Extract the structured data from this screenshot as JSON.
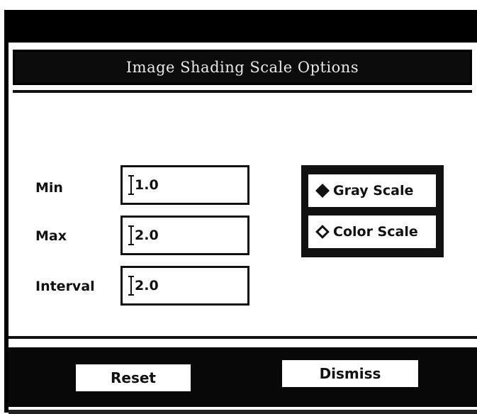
{
  "dialog": {
    "title": "Image Shading Scale Options"
  },
  "fields": {
    "min": {
      "label": "Min",
      "value": "1.0"
    },
    "max": {
      "label": "Max",
      "value": "2.0"
    },
    "interval": {
      "label": "Interval",
      "value": "2.0"
    }
  },
  "scale_options": {
    "selected": "Gray Scale",
    "gray_label": "Gray Scale",
    "color_label": "Color Scale"
  },
  "buttons": {
    "reset_label": "Reset",
    "dismiss_label": "Dismiss"
  },
  "colors": {
    "frame": "#000000",
    "background": "#ffffff"
  }
}
